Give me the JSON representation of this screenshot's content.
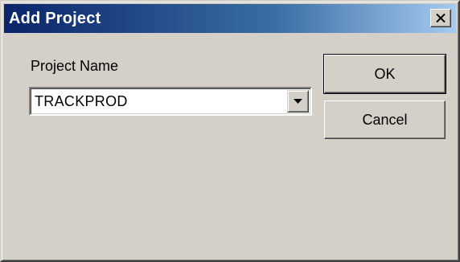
{
  "window": {
    "title": "Add Project",
    "close_icon": "close-icon"
  },
  "form": {
    "project_name_label": "Project Name",
    "project_name_value": "TRACKPROD",
    "dropdown_icon": "chevron-down-icon"
  },
  "buttons": {
    "ok_label": "OK",
    "cancel_label": "Cancel"
  },
  "colors": {
    "titlebar_start": "#0a246a",
    "titlebar_end": "#a6caf0",
    "dialog_bg": "#d4d0c8"
  }
}
